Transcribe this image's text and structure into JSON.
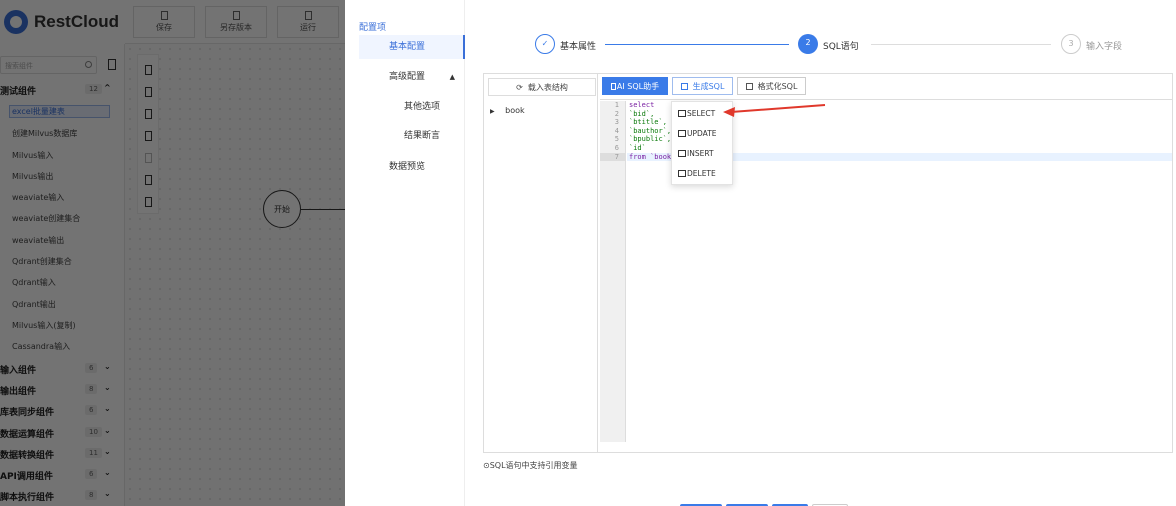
{
  "app": {
    "brand": "RestCloud"
  },
  "topbar": {
    "buttons": [
      "保存",
      "另存版本",
      "运行"
    ]
  },
  "sidebar": {
    "search_placeholder": "搜索组件",
    "groups_top": [
      {
        "label": "测试组件",
        "count": "12",
        "chevron": "^"
      }
    ],
    "components": [
      "excel批量建表",
      "创建Milvus数据库",
      "Milvus输入",
      "Milvus输出",
      "weaviate输入",
      "weaviate创建集合",
      "weaviate输出",
      "Qdrant创建集合",
      "Qdrant输入",
      "Qdrant输出",
      "Milvus输入(复制)",
      "Cassandra输入"
    ],
    "groups": [
      {
        "label": "输入组件",
        "count": "6"
      },
      {
        "label": "输出组件",
        "count": "8"
      },
      {
        "label": "库表同步组件",
        "count": "6"
      },
      {
        "label": "数据运算组件",
        "count": "10"
      },
      {
        "label": "数据转换组件",
        "count": "11"
      },
      {
        "label": "API调用组件",
        "count": "6"
      },
      {
        "label": "脚本执行组件",
        "count": "8"
      }
    ]
  },
  "canvas": {
    "start_node": "开始"
  },
  "drawer": {
    "nav": {
      "header": "配置项",
      "items": [
        "基本配置",
        "高级配置",
        "其他选项",
        "结果断言",
        "数据预览"
      ]
    },
    "steps": [
      {
        "num": "✓",
        "label": "基本属性"
      },
      {
        "num": "2",
        "label": "SQL语句"
      },
      {
        "num": "3",
        "label": "输入字段"
      }
    ],
    "left_pane": {
      "load_button": "载入表结构",
      "tree_item": "book"
    },
    "toolbar": {
      "ai_button": "AI SQL助手",
      "generate_button": "生成SQL",
      "format_button": "格式化SQL"
    },
    "code_lines": [
      "select",
      "`bid`,",
      "`btitle`,",
      "`bauthor`,",
      "`bpublic`,",
      "`id`",
      "from `book`"
    ],
    "line_numbers": [
      "1",
      "2",
      "3",
      "4",
      "5",
      "6",
      "7"
    ],
    "dropdown": [
      "SELECT",
      "UPDATE",
      "INSERT",
      "DELETE"
    ],
    "hint": "SQL语句中支持引用变量"
  },
  "colors": {
    "primary": "#3a7be8",
    "arrow": "#e0382b"
  }
}
